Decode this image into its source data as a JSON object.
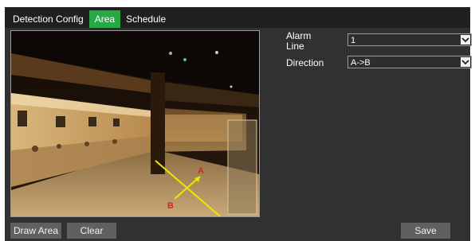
{
  "tabs": [
    {
      "label": "Detection Config"
    },
    {
      "label": "Area",
      "active": true
    },
    {
      "label": "Schedule"
    }
  ],
  "video": {
    "icons": [
      "line-end-marker-a-icon",
      "line-start-marker-b-icon"
    ],
    "alarm_line": {
      "color": "#f5e400",
      "start_marker": "B",
      "end_marker": "A",
      "marker_color": "#e02020"
    }
  },
  "form": {
    "alarm_line_label": "Alarm\nLine",
    "alarm_line_value": "1",
    "direction_label": "Direction",
    "direction_value": "A->B"
  },
  "buttons": {
    "draw_area": "Draw Area",
    "clear": "Clear",
    "save": "Save"
  },
  "colors": {
    "active_tab": "#28a745",
    "panel_bg": "#313131",
    "button_bg": "#606060"
  }
}
